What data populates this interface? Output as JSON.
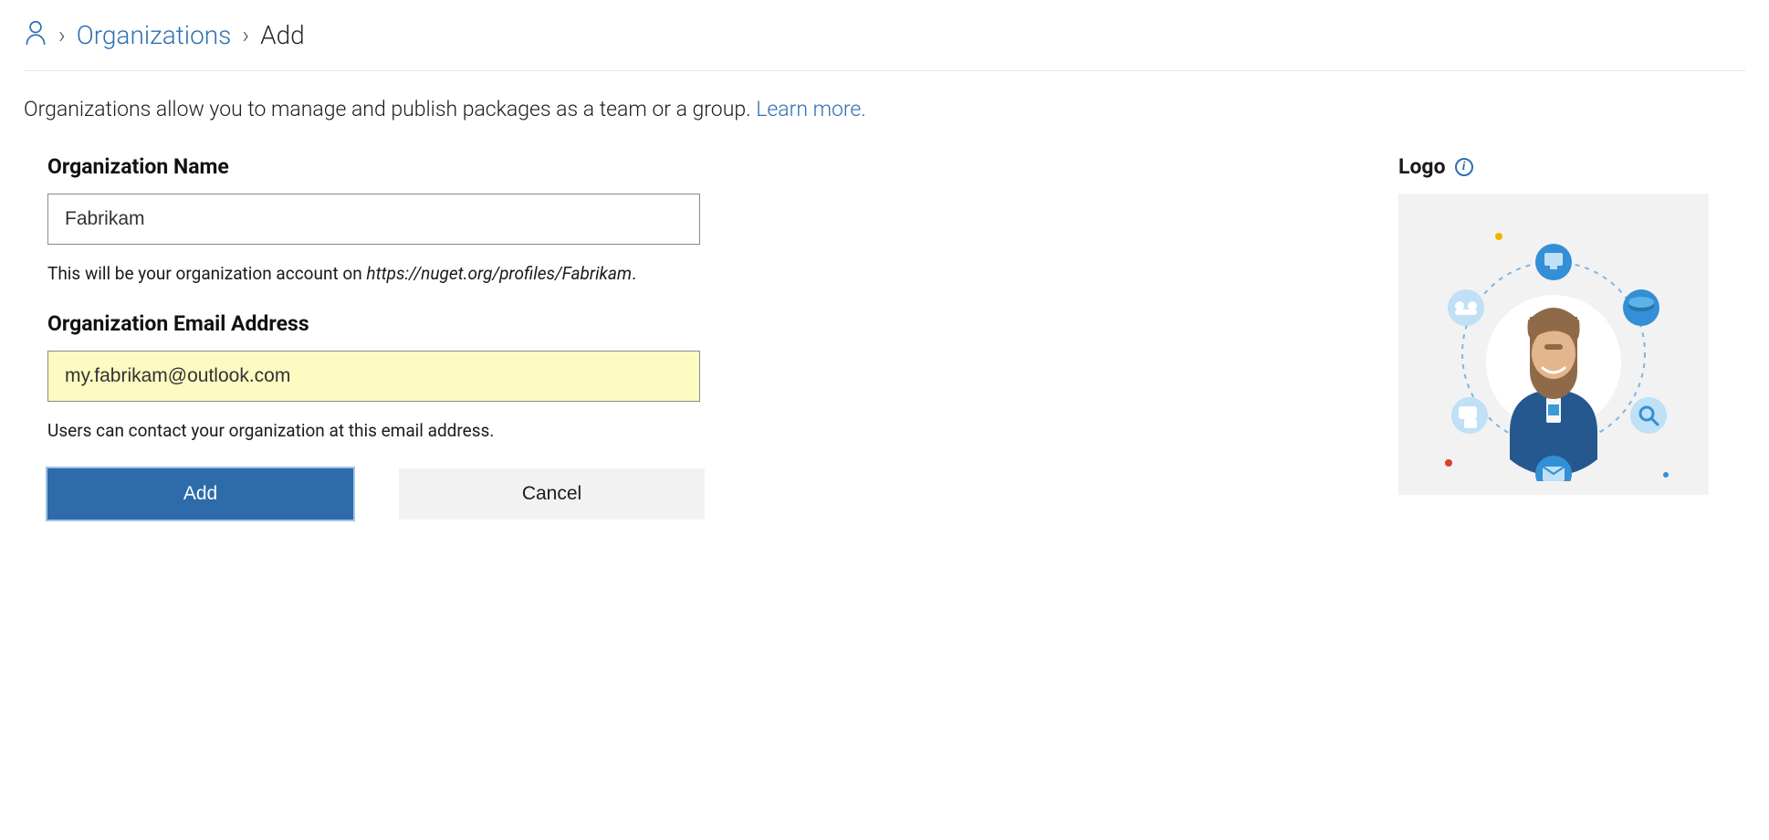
{
  "breadcrumb": {
    "organizations_label": "Organizations",
    "current_label": "Add"
  },
  "intro": {
    "text_before": "Organizations allow you to manage and publish packages as a team or a group. ",
    "learn_more_label": "Learn more."
  },
  "form": {
    "org_name": {
      "label": "Organization Name",
      "value": "Fabrikam",
      "hint_prefix": "This will be your organization account on ",
      "hint_url": "https://nuget.org/profiles/Fabrikam",
      "hint_suffix": "."
    },
    "org_email": {
      "label": "Organization Email Address",
      "value": "my.fabrikam@outlook.com",
      "hint": "Users can contact your organization at this email address."
    },
    "add_button_label": "Add",
    "cancel_button_label": "Cancel"
  },
  "logo": {
    "label": "Logo"
  }
}
